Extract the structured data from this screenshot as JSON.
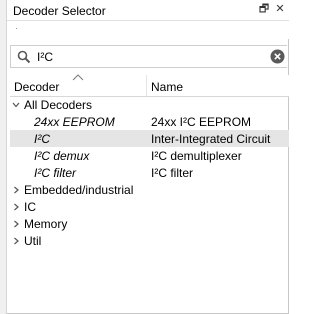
{
  "window": {
    "title": "Decoder Selector",
    "float_icon": "restore-window-icon",
    "close_icon": "close-icon",
    "float_glyph": "🗗",
    "close_glyph": "✕"
  },
  "search": {
    "value": "I²C",
    "placeholder": ""
  },
  "columns": {
    "decoder": "Decoder",
    "name": "Name"
  },
  "tree": {
    "all_decoders": {
      "label": "All Decoders",
      "expanded": true,
      "children": [
        {
          "label": "24xx EEPROM",
          "name": "24xx I²C EEPROM",
          "selected": false
        },
        {
          "label": "I²C",
          "name": "Inter-Integrated Circuit",
          "selected": true
        },
        {
          "label": "I²C demux",
          "name": "I²C demultiplexer",
          "selected": false
        },
        {
          "label": "I²C filter",
          "name": "I²C filter",
          "selected": false
        }
      ]
    },
    "categories": [
      {
        "label": "Embedded/industrial",
        "expanded": false
      },
      {
        "label": "IC",
        "expanded": false
      },
      {
        "label": "Memory",
        "expanded": false
      },
      {
        "label": "Util",
        "expanded": false
      }
    ]
  },
  "colors": {
    "selected_row": "#e5e5e5",
    "arrow": "#555555"
  }
}
